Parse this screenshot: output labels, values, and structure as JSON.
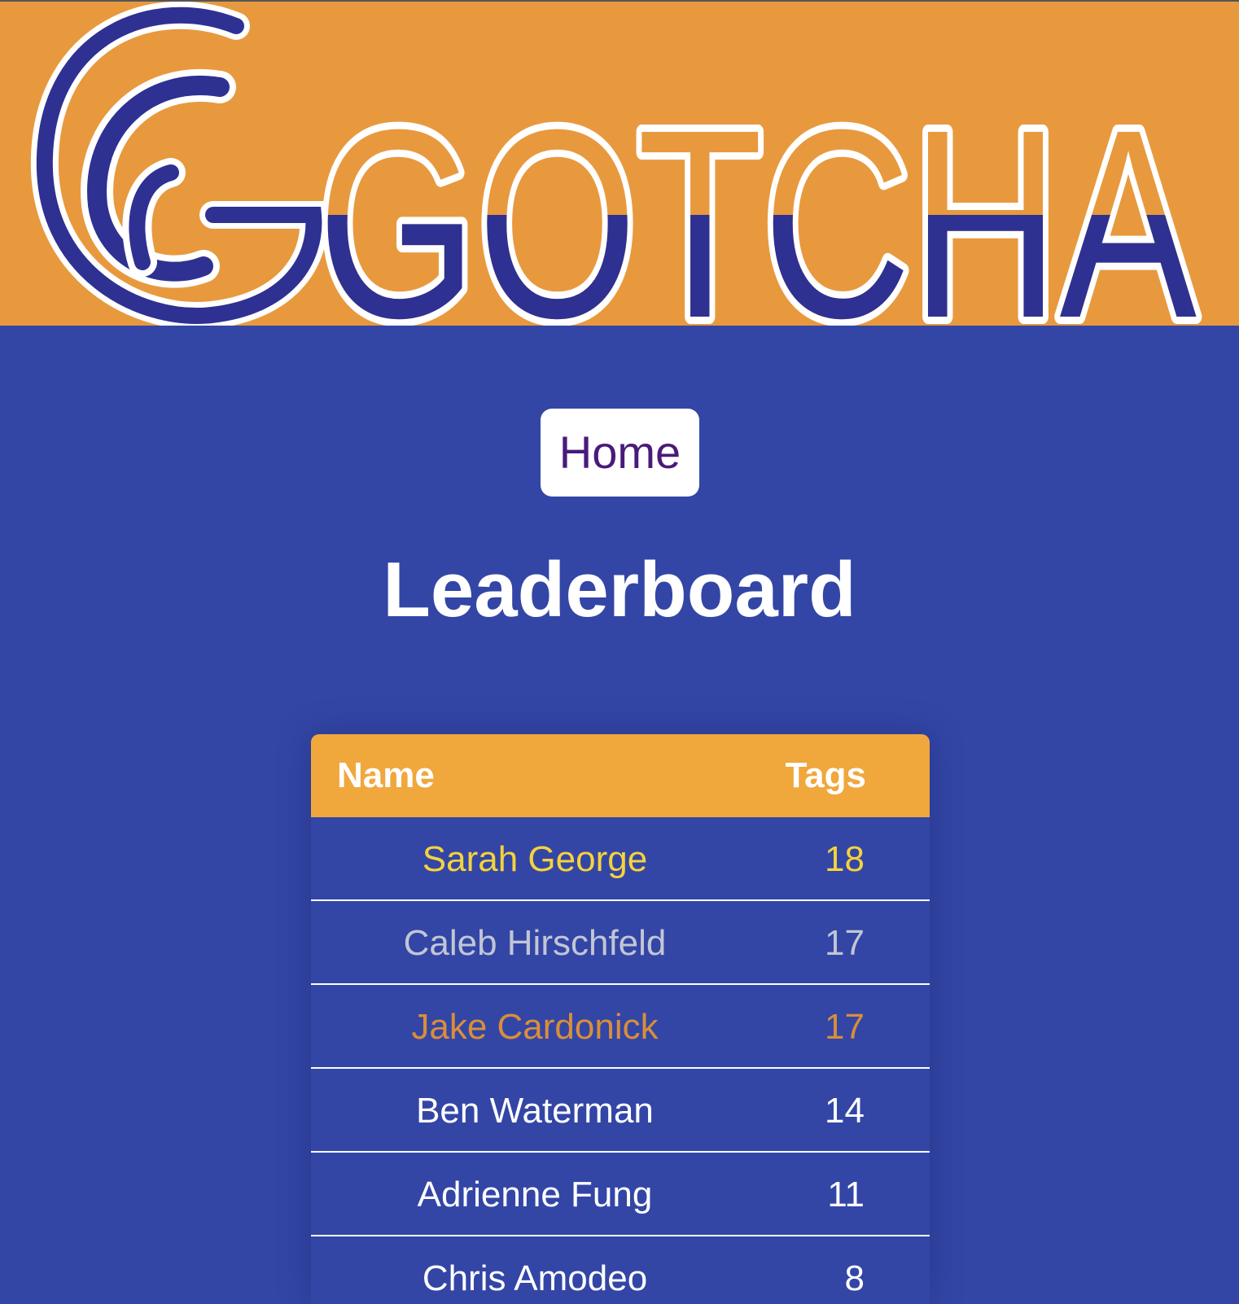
{
  "header": {
    "logo_text": "GOTCHA",
    "colors": {
      "banner": "#e8993e",
      "logo_fill": "#2e3191",
      "logo_outline": "#ffffff"
    }
  },
  "nav": {
    "home_label": "Home"
  },
  "page": {
    "title": "Leaderboard"
  },
  "leaderboard": {
    "columns": {
      "name": "Name",
      "tags": "Tags"
    },
    "rows": [
      {
        "name": "Sarah George",
        "tags": "18",
        "color": "#f5d23c"
      },
      {
        "name": "Caleb Hirschfeld",
        "tags": "17",
        "color": "#c2c6d4"
      },
      {
        "name": "Jake Cardonick",
        "tags": "17",
        "color": "#d98e3a"
      },
      {
        "name": "Ben Waterman",
        "tags": "14",
        "color": "#ffffff"
      },
      {
        "name": "Adrienne Fung",
        "tags": "11",
        "color": "#ffffff"
      },
      {
        "name": "Chris Amodeo",
        "tags": "8",
        "color": "#ffffff"
      }
    ]
  }
}
